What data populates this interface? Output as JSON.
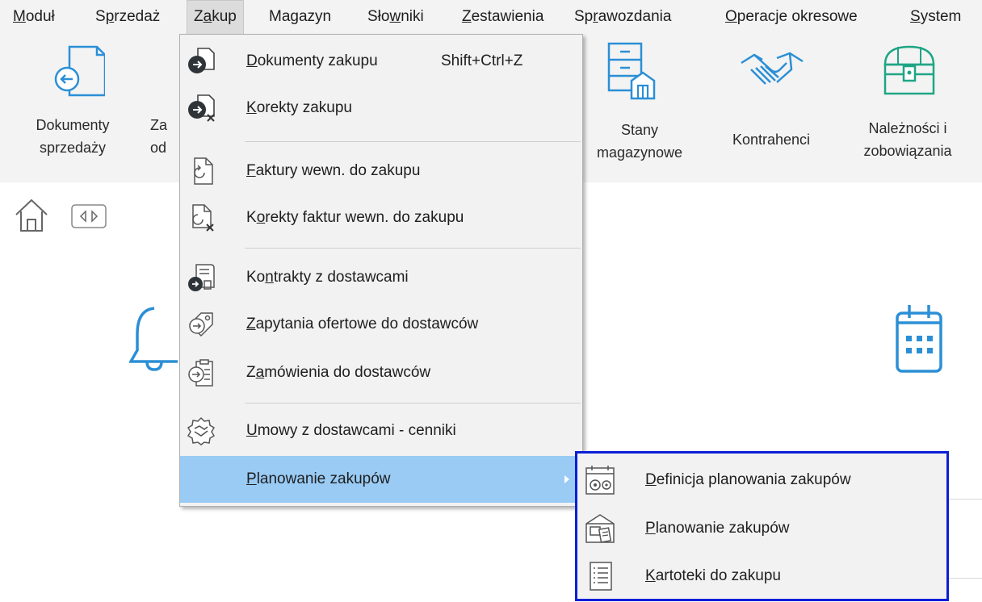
{
  "menubar": {
    "items": [
      {
        "label": "Moduł"
      },
      {
        "label": "Sprzedaż"
      },
      {
        "label": "Zakup"
      },
      {
        "label": "Magazyn"
      },
      {
        "label": "Słowniki"
      },
      {
        "label": "Zestawienia"
      },
      {
        "label": "Sprawozdania"
      },
      {
        "label": "Operacje okresowe"
      },
      {
        "label": "System"
      }
    ]
  },
  "ribbon": {
    "buttons": [
      {
        "line1": "Dokumenty",
        "line2": "sprzedaży",
        "icon": "document-arrow-left-icon"
      },
      {
        "line1": "Za",
        "line2": "od",
        "icon": "partially-hidden"
      },
      {
        "line1": "Stany",
        "line2": "magazynowe",
        "icon": "warehouse-cabinet-icon"
      },
      {
        "line1": "Kontrahenci",
        "line2": "",
        "icon": "handshake-icon"
      },
      {
        "line1": "Należności i",
        "line2": "zobowiązania",
        "icon": "treasure-chest-icon"
      }
    ],
    "icon_color": "#2b8fd6",
    "chest_color": "#1fa585"
  },
  "tabs": {
    "home_icon": "home-icon",
    "nav_icon": "arrows-left-right-icon"
  },
  "dropdown": {
    "items": [
      {
        "label": "Dokumenty zakupu",
        "shortcut": "Shift+Ctrl+Z",
        "icon": "document-arrow-icon"
      },
      {
        "label": "Korekty zakupu",
        "icon": "document-correction-icon"
      },
      {
        "label": "Faktury wewn. do zakupu",
        "icon": "internal-invoice-icon"
      },
      {
        "label": "Korekty faktur wewn. do zakupu",
        "icon": "internal-invoice-correction-icon"
      },
      {
        "label": "Kontrakty z dostawcami",
        "icon": "contract-icon"
      },
      {
        "label": "Zapytania ofertowe do dostawców",
        "icon": "tag-arrow-icon"
      },
      {
        "label": "Zamówienia do dostawców",
        "icon": "clipboard-arrow-icon"
      },
      {
        "label": "Umowy z dostawcami - cenniki",
        "icon": "handshake-seal-icon"
      },
      {
        "label": "Planowanie zakupów",
        "icon": "",
        "highlighted": true
      }
    ],
    "highlight_color": "#99cbf5"
  },
  "submenu": {
    "items": [
      {
        "label": "Definicja planowania zakupów",
        "icon": "calendar-gears-icon"
      },
      {
        "label": "Planowanie zakupów",
        "icon": "warehouse-list-icon"
      },
      {
        "label": "Kartoteki do zakupu",
        "icon": "list-document-icon"
      }
    ],
    "border_color": "#0b1fd6"
  },
  "background": {
    "bell_icon": "bell-icon",
    "calendar_icon": "calendar-icon"
  }
}
